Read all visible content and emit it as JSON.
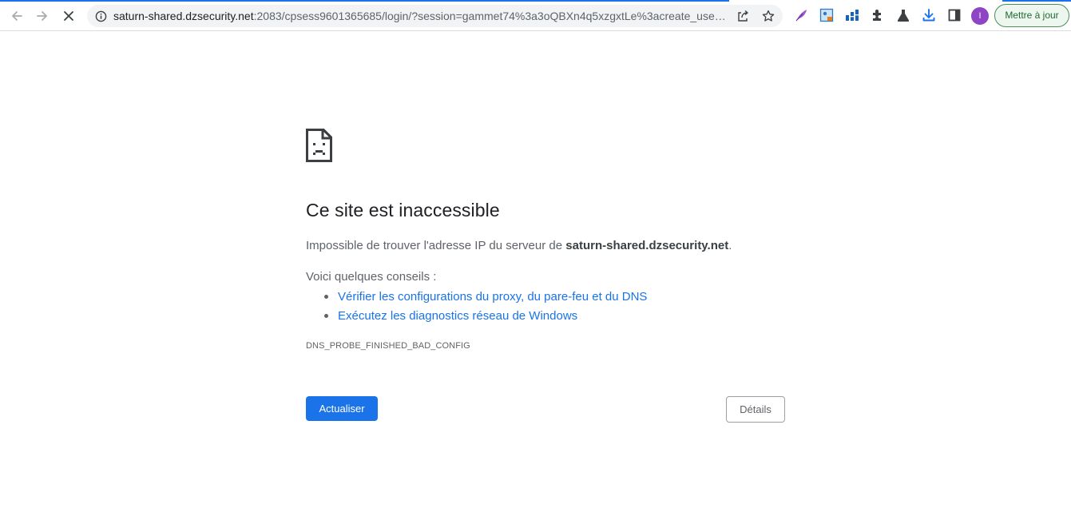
{
  "browser": {
    "url_host": "saturn-shared.dzsecurity.net",
    "url_rest": ":2083/cpsess9601365685/login/?session=gammet74%3a3oQBXn4q5xzgxtLe%3acreate_user_se...",
    "avatar_letter": "I",
    "update_label": "Mettre à jour",
    "accent_color": "#1a73e8",
    "extensions": [
      "feather-icon",
      "image-extension-icon",
      "chart-grid-icon",
      "puzzle-icon",
      "flask-icon",
      "download-icon",
      "sidebar-icon"
    ]
  },
  "error_page": {
    "title": "Ce site est inaccessible",
    "desc_prefix": "Impossible de trouver l'adresse IP du serveur de ",
    "desc_host": "saturn-shared.dzsecurity.net",
    "desc_suffix": ".",
    "tips_intro": "Voici quelques conseils :",
    "tips": [
      "Vérifier les configurations du proxy, du pare-feu et du DNS",
      "Exécutez les diagnostics réseau de Windows"
    ],
    "error_code": "DNS_PROBE_FINISHED_BAD_CONFIG",
    "reload_label": "Actualiser",
    "details_label": "Détails"
  }
}
